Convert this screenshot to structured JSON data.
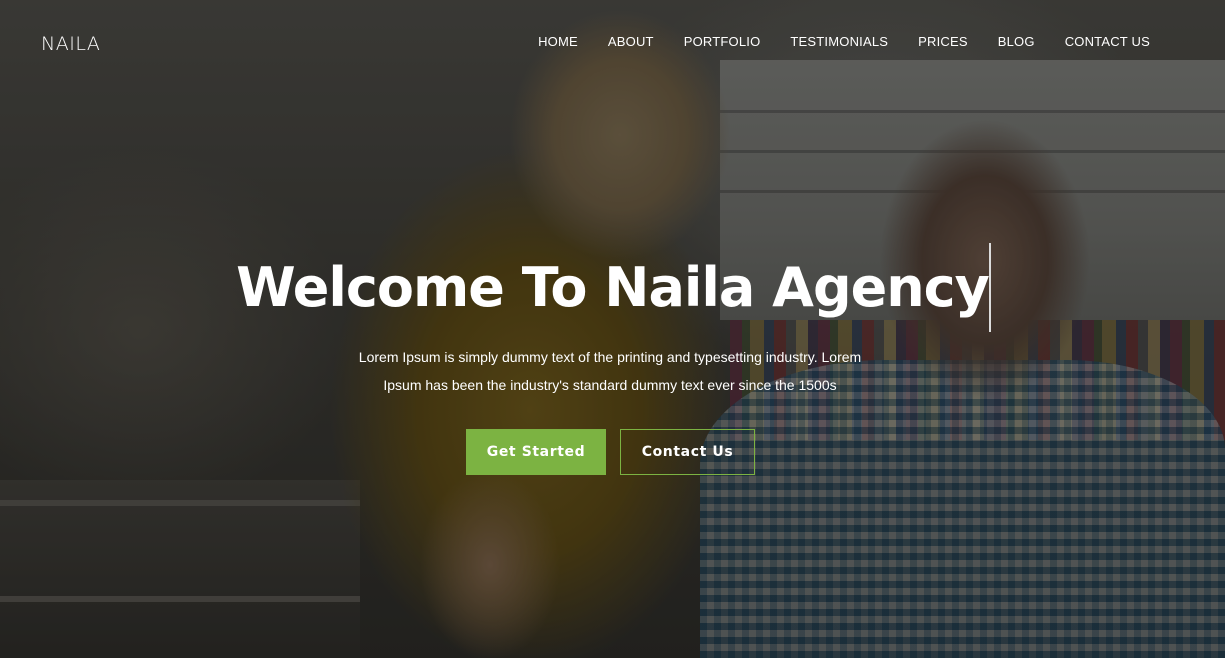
{
  "brand": {
    "logo_text": "NAILA",
    "accent_color": "#7cb342"
  },
  "nav": {
    "items": [
      {
        "label": "HOME"
      },
      {
        "label": "ABOUT"
      },
      {
        "label": "PORTFOLIO"
      },
      {
        "label": "TESTIMONIALS"
      },
      {
        "label": "PRICES"
      },
      {
        "label": "BLOG"
      },
      {
        "label": "CONTACT US"
      }
    ]
  },
  "hero": {
    "title": "Welcome To Naila Agency",
    "description_line1": "Lorem Ipsum is simply dummy text of the printing and typesetting industry. Lorem",
    "description_line2": "Ipsum has been the industry's standard dummy text ever since the 1500s",
    "primary_button_label": "Get Started",
    "secondary_button_label": "Contact Us"
  }
}
